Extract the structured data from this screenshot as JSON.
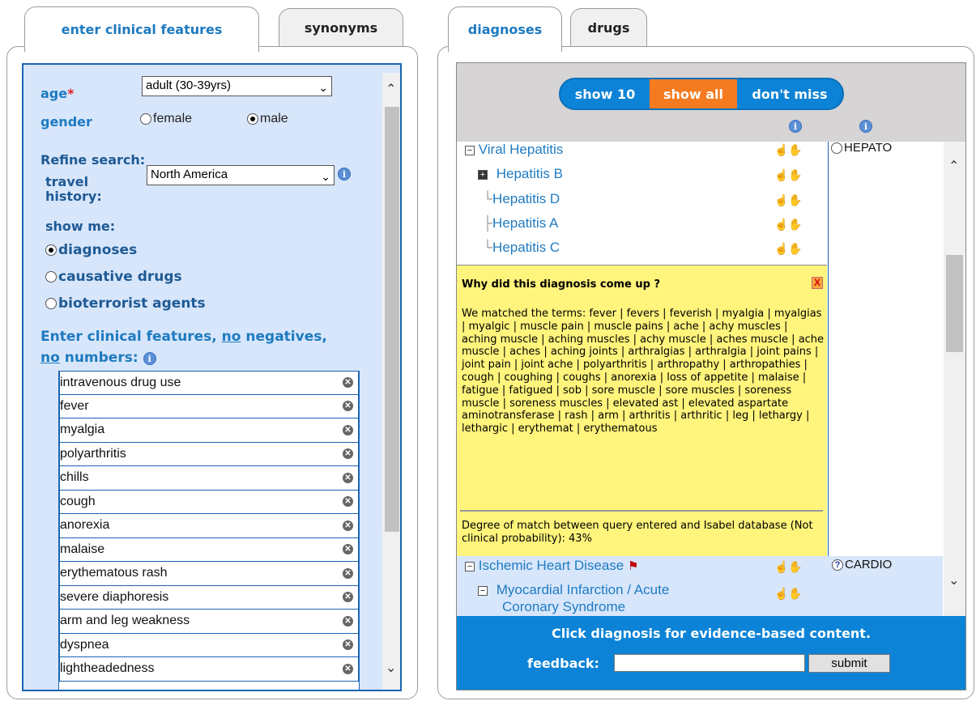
{
  "left_tabs": {
    "active": "enter clinical features",
    "inactive": "synonyms"
  },
  "right_tabs": {
    "active": "diagnoses",
    "inactive": "drugs"
  },
  "form": {
    "age_label": "age",
    "age_required_mark": "*",
    "age_value": "adult (30-39yrs)",
    "gender_label": "gender",
    "gender_options": [
      "female",
      "male"
    ],
    "gender_selected": "male",
    "refine_label": "Refine search:",
    "travel_label_1": "travel",
    "travel_label_2": "history:",
    "travel_value": "North America",
    "show_me_label": "show me:",
    "show_me_options": [
      "diagnoses",
      "causative drugs",
      "bioterrorist agents"
    ],
    "show_me_selected": "diagnoses",
    "features_prompt_1": "Enter clinical features,",
    "features_prompt_no1": "no",
    "features_prompt_2": "negatives,",
    "features_prompt_no2": "no",
    "features_prompt_3": "numbers:"
  },
  "terms": [
    "intravenous drug use",
    "fever",
    "myalgia",
    "polyarthritis",
    "chills",
    "cough",
    "anorexia",
    "malaise",
    "erythematous rash",
    "severe diaphoresis",
    "arm and leg weakness",
    "dyspnea",
    "lightheadedness"
  ],
  "filters": {
    "show10": "show 10",
    "showall": "show all",
    "dontmiss": "don't miss",
    "selected": "show all"
  },
  "diagnoses": {
    "group1": "Viral Hepatitis",
    "group1_tag": "HEPATO",
    "children": [
      "Hepatitis B",
      "Hepatitis D",
      "Hepatitis A",
      "Hepatitis C"
    ],
    "group2": "Ischemic Heart Disease",
    "group2_tag": "CARDIO",
    "group2_child_1": "Myocardial Infarction / Acute",
    "group2_child_2": "Coronary Syndrome"
  },
  "popup": {
    "title": "Why did this diagnosis come up ?",
    "close": "X",
    "body": "We matched the terms: fever | fevers | feverish | myalgia | myalgias | myalgic | muscle pain | muscle pains | ache | achy muscles | aching muscle | aching muscles | achy muscle | aches muscle | ache muscle | aches | aching joints | arthralgias | arthralgia | joint pains | joint pain | joint ache | polyarthritis | arthropathy | arthropathies | cough | coughing | coughs | anorexia | loss of appetite | malaise | fatigue | fatigued | sob | sore muscle | sore muscles | soreness muscle | soreness muscles | elevated ast | elevated aspartate aminotransferase | rash | arm | arthritis | arthritic | leg | lethargy | lethargic | erythemat | erythematous",
    "footer": "Degree of match between query entered and Isabel database (Not clinical probability): 43%"
  },
  "footer": {
    "hint": "Click diagnosis for evidence-based content.",
    "feedback_label": "feedback:",
    "feedback_value": "",
    "submit": "submit"
  },
  "colors": {
    "accent": "#1e7ac0",
    "orange": "#f47b20",
    "footer_blue": "#0c83d6",
    "panel_blue": "#d7e6fb",
    "popup_yellow": "#fff47c"
  }
}
